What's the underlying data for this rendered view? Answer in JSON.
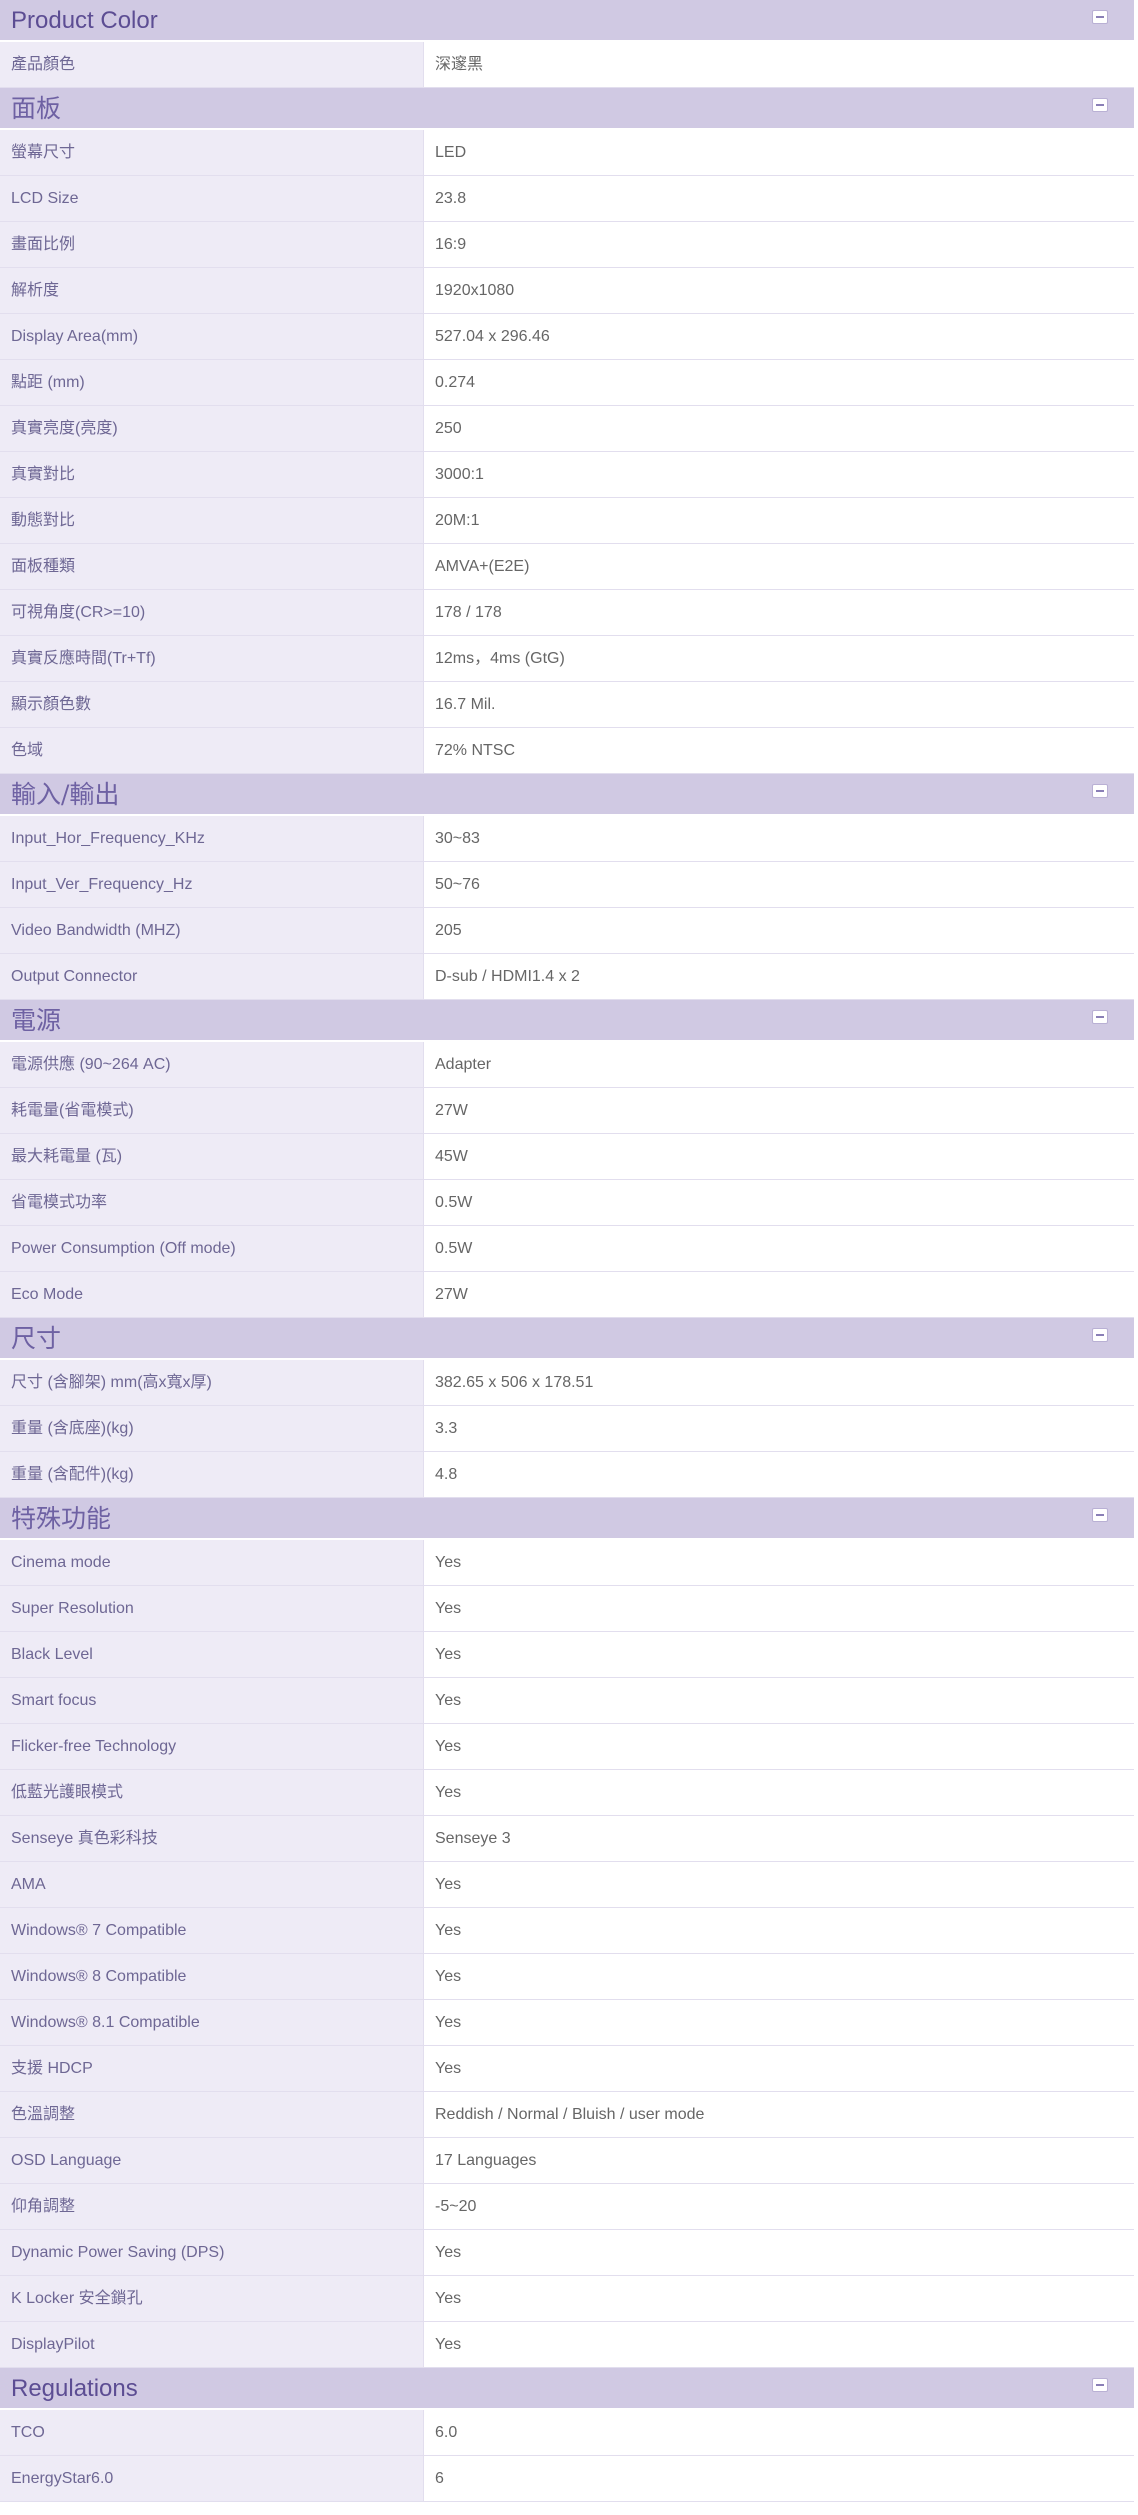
{
  "sections": [
    {
      "title": "Product Color",
      "rows": [
        {
          "label": "產品顏色",
          "value": "深邃黑"
        }
      ]
    },
    {
      "title": "面板",
      "rows": [
        {
          "label": "螢幕尺寸",
          "value": "LED"
        },
        {
          "label": "LCD Size",
          "value": "23.8"
        },
        {
          "label": "畫面比例",
          "value": "16:9"
        },
        {
          "label": "解析度",
          "value": "1920x1080"
        },
        {
          "label": "Display Area(mm)",
          "value": "527.04 x 296.46"
        },
        {
          "label": "點距 (mm)",
          "value": "0.274"
        },
        {
          "label": "真實亮度(亮度)",
          "value": "250"
        },
        {
          "label": "真實對比",
          "value": "3000:1"
        },
        {
          "label": "動態對比",
          "value": "20M:1"
        },
        {
          "label": "面板種類",
          "value": "AMVA+(E2E)"
        },
        {
          "label": "可視角度(CR>=10)",
          "value": "178 / 178"
        },
        {
          "label": "真實反應時間(Tr+Tf)",
          "value": "12ms，4ms (GtG)"
        },
        {
          "label": "顯示顏色數",
          "value": "16.7 Mil."
        },
        {
          "label": "色域",
          "value": "72% NTSC"
        }
      ]
    },
    {
      "title": "輸入/輸出",
      "rows": [
        {
          "label": "Input_Hor_Frequency_KHz",
          "value": "30~83"
        },
        {
          "label": "Input_Ver_Frequency_Hz",
          "value": "50~76"
        },
        {
          "label": "Video Bandwidth (MHZ)",
          "value": "205"
        },
        {
          "label": "Output Connector",
          "value": "D-sub / HDMI1.4 x 2"
        }
      ]
    },
    {
      "title": "電源",
      "rows": [
        {
          "label": "電源供應 (90~264 AC)",
          "value": "Adapter"
        },
        {
          "label": "耗電量(省電模式)",
          "value": "27W"
        },
        {
          "label": "最大耗電量 (瓦)",
          "value": "45W"
        },
        {
          "label": "省電模式功率",
          "value": "0.5W"
        },
        {
          "label": "Power Consumption (Off mode)",
          "value": "0.5W"
        },
        {
          "label": "Eco Mode",
          "value": "27W"
        }
      ]
    },
    {
      "title": "尺寸",
      "rows": [
        {
          "label": "尺寸 (含腳架) mm(高x寬x厚)",
          "value": "382.65 x 506 x 178.51"
        },
        {
          "label": "重量 (含底座)(kg)",
          "value": "3.3"
        },
        {
          "label": "重量 (含配件)(kg)",
          "value": "4.8"
        }
      ]
    },
    {
      "title": "特殊功能",
      "rows": [
        {
          "label": "Cinema mode",
          "value": "Yes"
        },
        {
          "label": "Super Resolution",
          "value": "Yes"
        },
        {
          "label": "Black Level",
          "value": "Yes"
        },
        {
          "label": "Smart focus",
          "value": "Yes"
        },
        {
          "label": "Flicker-free Technology",
          "value": "Yes"
        },
        {
          "label": "低藍光護眼模式",
          "value": "Yes"
        },
        {
          "label": "Senseye 真色彩科技",
          "value": "Senseye 3"
        },
        {
          "label": "AMA",
          "value": "Yes"
        },
        {
          "label": "Windows® 7 Compatible",
          "value": "Yes"
        },
        {
          "label": "Windows® 8 Compatible",
          "value": "Yes"
        },
        {
          "label": "Windows® 8.1 Compatible",
          "value": "Yes"
        },
        {
          "label": "支援 HDCP",
          "value": "Yes"
        },
        {
          "label": "色溫調整",
          "value": "Reddish / Normal / Bluish / user mode"
        },
        {
          "label": "OSD Language",
          "value": "17 Languages"
        },
        {
          "label": "仰角調整",
          "value": "-5~20"
        },
        {
          "label": "Dynamic Power Saving (DPS)",
          "value": "Yes"
        },
        {
          "label": "K Locker 安全鎖孔",
          "value": "Yes"
        },
        {
          "label": "DisplayPilot",
          "value": "Yes"
        }
      ]
    },
    {
      "title": "Regulations",
      "rows": [
        {
          "label": "TCO",
          "value": "6.0"
        },
        {
          "label": "EnergyStar6.0",
          "value": "6"
        }
      ]
    }
  ],
  "icons": {
    "collapse": "minus-square-icon"
  },
  "colors": {
    "header_bg": "#d0c9e3",
    "header_text": "#5c4d93",
    "label_bg": "#eeebf6",
    "value_bg": "#ffffff"
  }
}
